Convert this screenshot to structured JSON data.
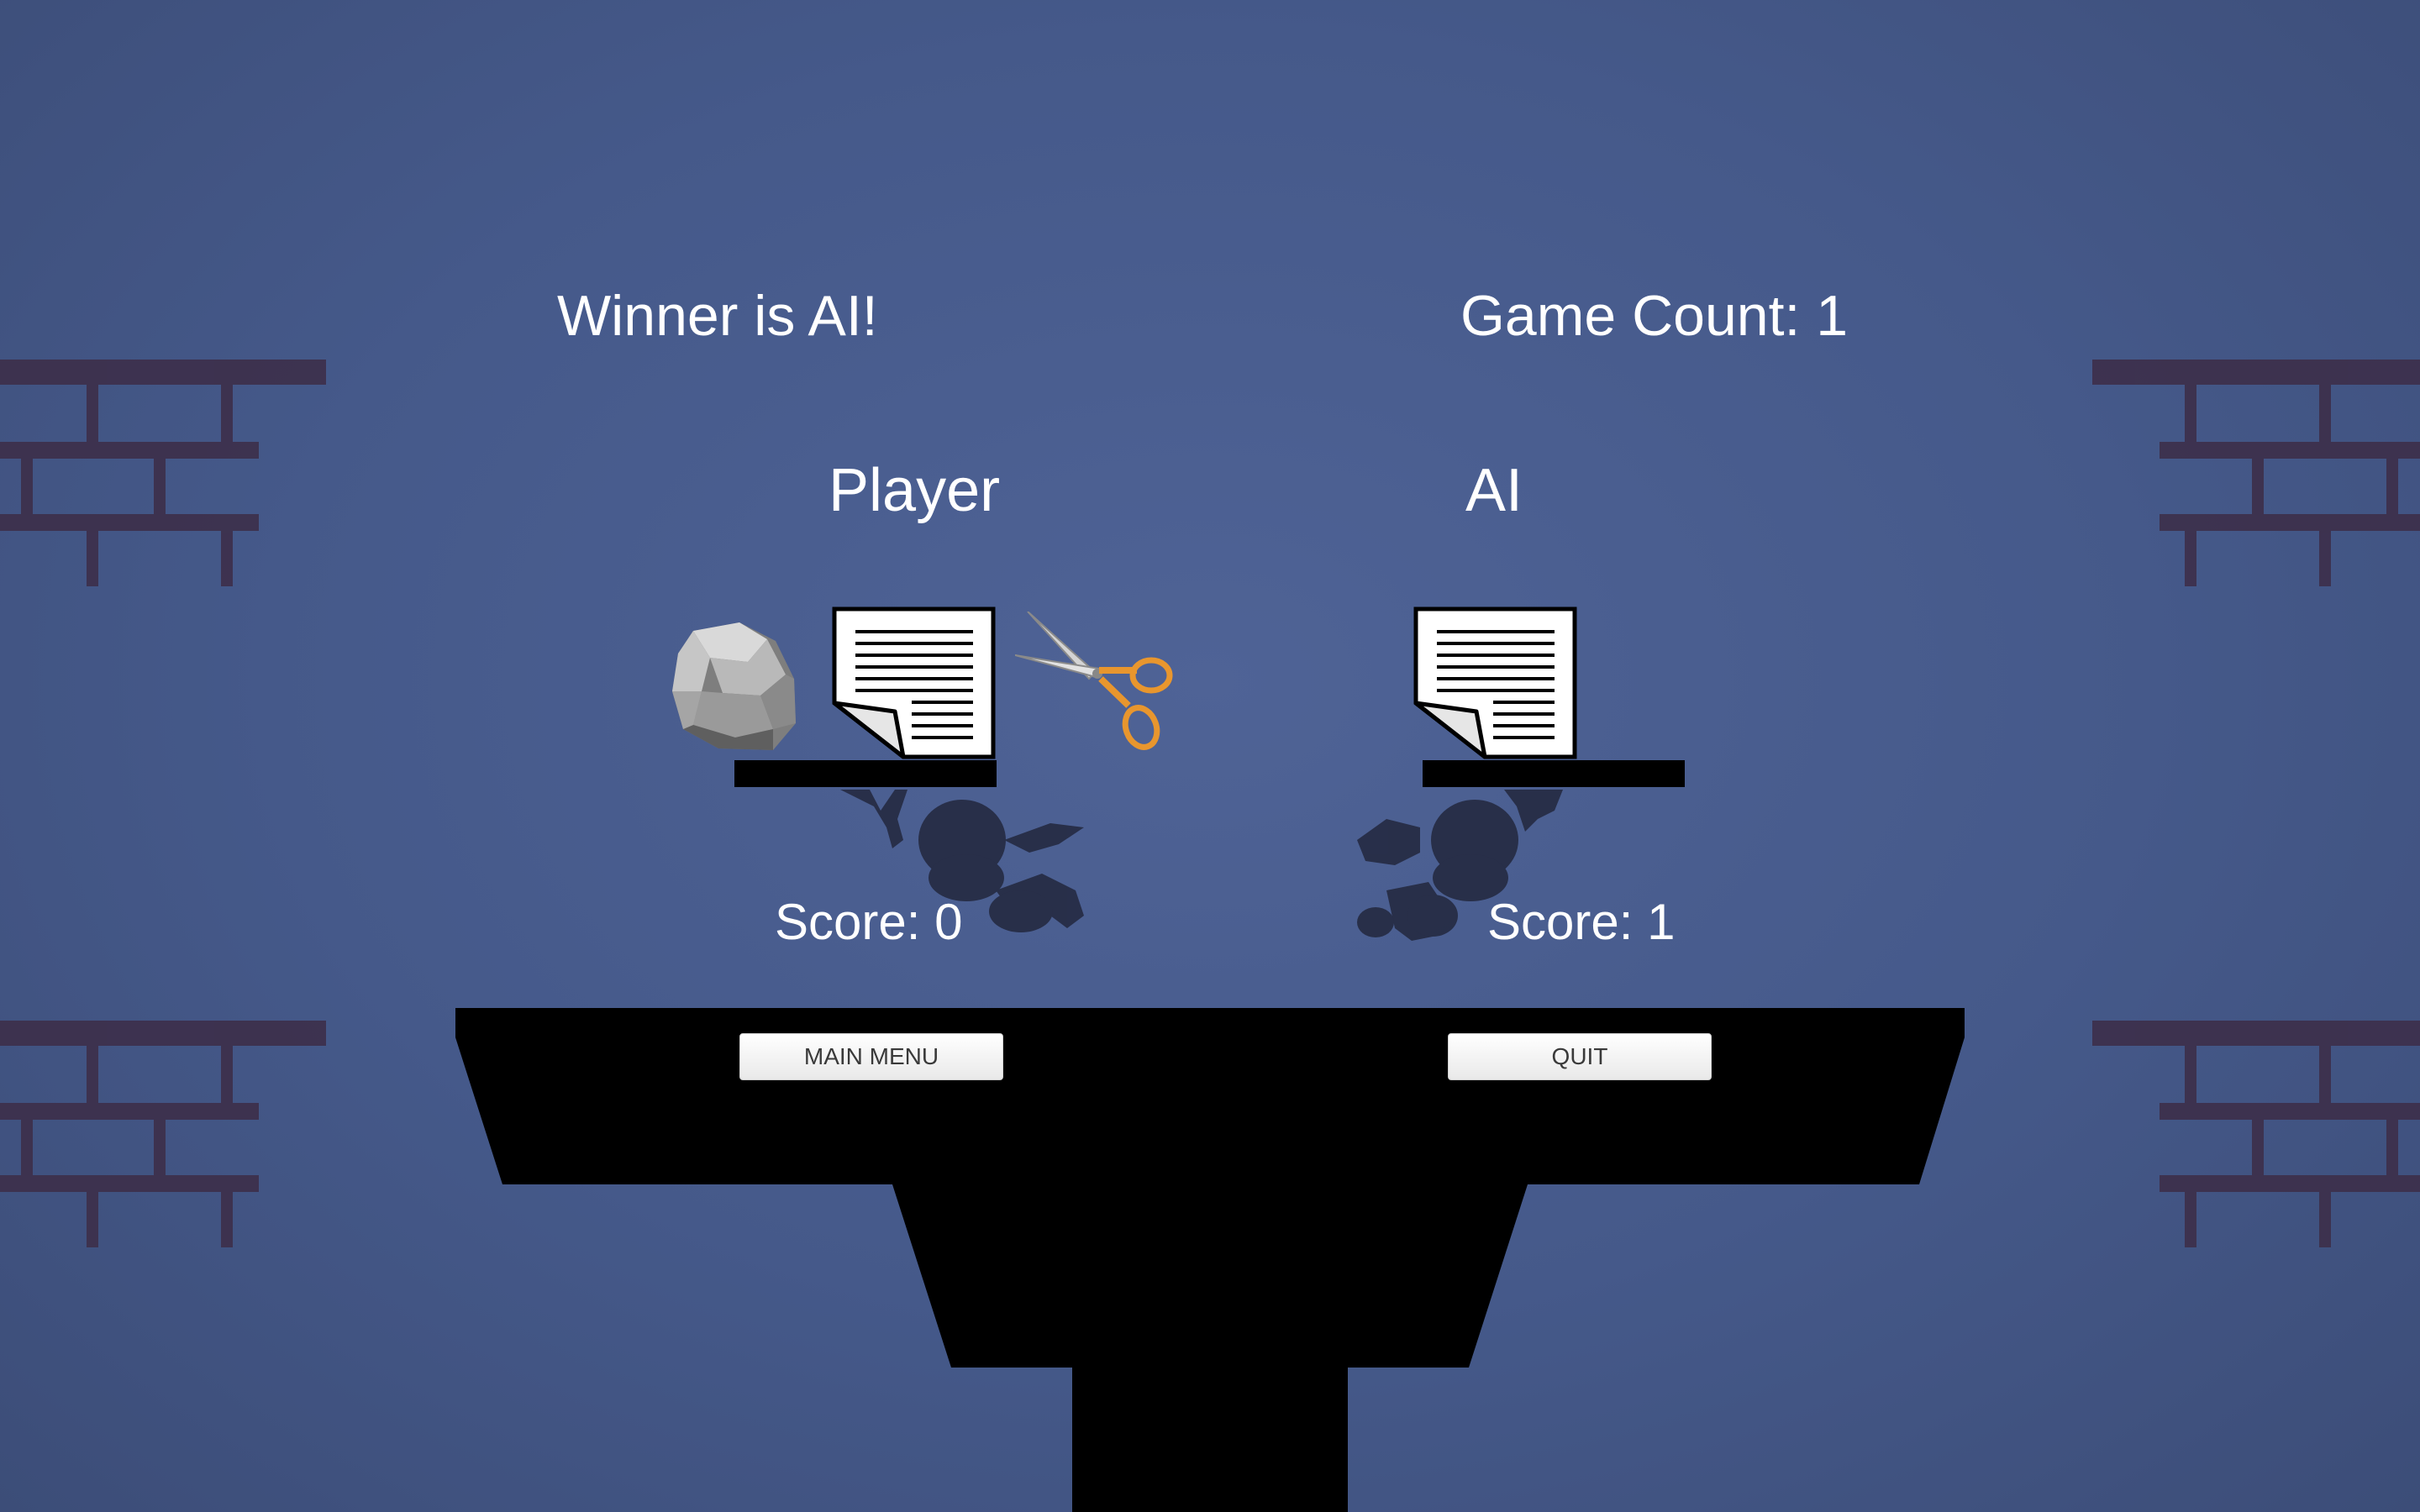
{
  "hud": {
    "winner": "Winner is AI!",
    "game_count": "Game Count: 1"
  },
  "player": {
    "label": "Player",
    "score": "Score: 0",
    "choices": [
      "rock",
      "paper",
      "scissors"
    ]
  },
  "ai": {
    "label": "AI",
    "score": "Score: 1",
    "choice": "paper"
  },
  "buttons": {
    "main_menu": "MAIN MENU",
    "quit": "QUIT"
  },
  "colors": {
    "background": "#45598a",
    "bricks": "#3d2f4a",
    "silhouette": "#000000",
    "hud_text": "#ffffff",
    "button_bg": "#f2f2f2",
    "scissors_handle": "#e8962e"
  },
  "icons": [
    "brick-wall-icon",
    "rock-icon",
    "paper-icon",
    "scissors-icon",
    "character-shadow-icon"
  ]
}
